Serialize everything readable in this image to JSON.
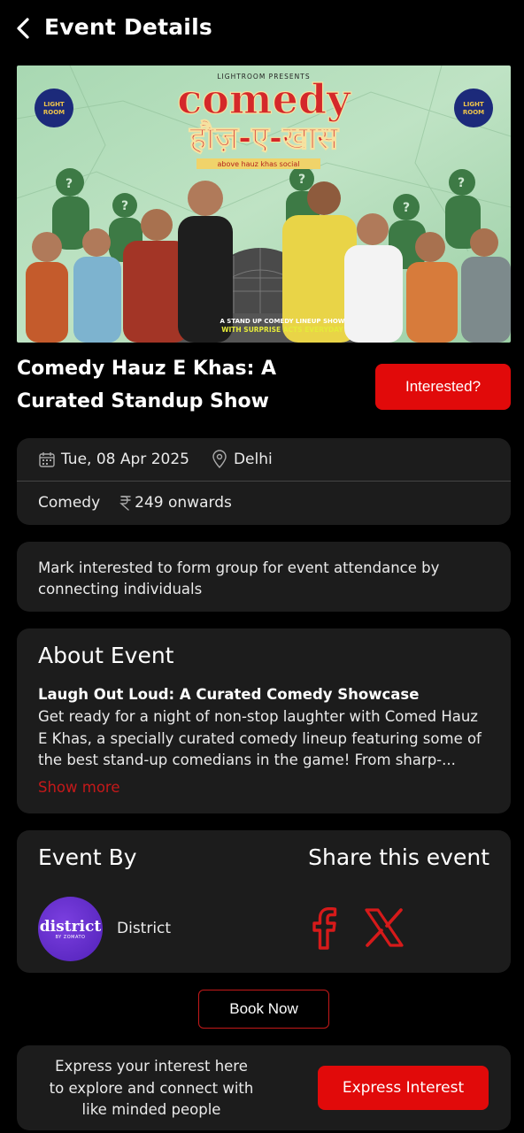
{
  "header": {
    "title": "Event Details",
    "back_icon": "chevron-left-icon"
  },
  "banner": {
    "presenter": "LIGHTROOM PRESENTS",
    "title_en": "comedy",
    "title_hi": "हौज़-ए-खास",
    "venue_tag": "above hauz khas social",
    "tagline_1": "A STAND UP COMEDY LINEUP SHOW",
    "tagline_2": "WITH SURPRISE ACTS EVERYDAY",
    "logo_text_1": "LIGHT",
    "logo_text_2": "ROOM"
  },
  "event": {
    "title": "Comedy Hauz E Khas: A Curated Standup Show",
    "interested_label": "Interested?"
  },
  "info": {
    "date": "Tue, 08 Apr 2025",
    "location": "Delhi",
    "category": "Comedy",
    "price": "249 onwards",
    "calendar_icon": "calendar-icon",
    "location_icon": "location-pin-icon",
    "currency_icon": "rupee-icon"
  },
  "notice": {
    "text": "Mark interested to form group for event attendance by connecting individuals"
  },
  "about": {
    "heading": "About Event",
    "subheading": "Laugh Out Loud: A Curated Comedy Showcase",
    "body": "Get ready for a night of non-stop laughter with Comed Hauz E Khas, a specially curated comedy lineup featuring some of the best stand-up comedians in the game! From sharp-...",
    "show_more": "Show more"
  },
  "organizer": {
    "heading": "Event By",
    "name": "District",
    "logo_main": "district",
    "logo_sub": "BY ZOMATO"
  },
  "share": {
    "heading": "Share this event",
    "facebook_icon": "facebook-icon",
    "x_icon": "x-icon"
  },
  "actions": {
    "book_now": "Book Now"
  },
  "express": {
    "text": "Express your interest here to explore and connect with like minded people",
    "button": "Express Interest"
  },
  "colors": {
    "accent": "#e10a0a",
    "card": "#1c1c1c",
    "link": "#c4191a",
    "background": "#000000"
  }
}
